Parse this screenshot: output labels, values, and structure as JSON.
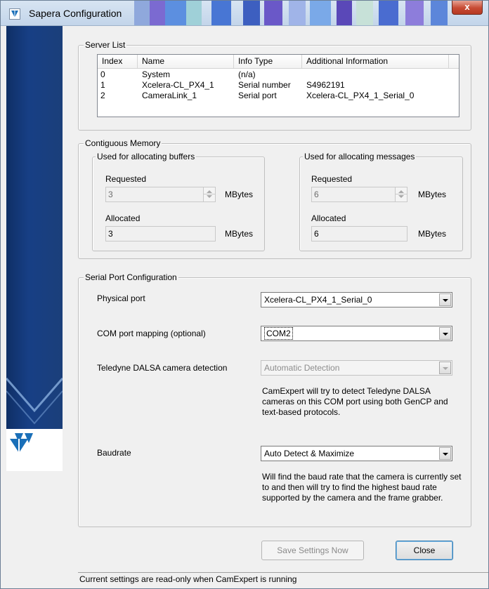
{
  "window": {
    "title": "Sapera Configuration",
    "close_glyph": "x"
  },
  "server_list": {
    "group_label": "Server List",
    "columns": [
      "Index",
      "Name",
      "Info Type",
      "Additional Information"
    ],
    "rows": [
      [
        "0",
        "System",
        "(n/a)",
        ""
      ],
      [
        "1",
        "Xcelera-CL_PX4_1",
        "Serial number",
        "S4962191"
      ],
      [
        "2",
        "CameraLink_1",
        "Serial port",
        "Xcelera-CL_PX4_1_Serial_0"
      ]
    ]
  },
  "contiguous_memory": {
    "group_label": "Contiguous Memory",
    "buffers": {
      "group_label": "Used for allocating buffers",
      "requested_label": "Requested",
      "requested_value": "3",
      "allocated_label": "Allocated",
      "allocated_value": "3",
      "unit": "MBytes"
    },
    "messages": {
      "group_label": "Used for allocating messages",
      "requested_label": "Requested",
      "requested_value": "6",
      "allocated_label": "Allocated",
      "allocated_value": "6",
      "unit": "MBytes"
    }
  },
  "serial_port": {
    "group_label": "Serial Port Configuration",
    "physical_port_label": "Physical port",
    "physical_port_value": "Xcelera-CL_PX4_1_Serial_0",
    "com_mapping_label": "COM port mapping (optional)",
    "com_mapping_value": "COM2",
    "detection_label": "Teledyne DALSA camera detection",
    "detection_value": "Automatic Detection",
    "detection_desc": "CamExpert will try to detect Teledyne DALSA cameras on this COM port using both GenCP and text-based protocols.",
    "baudrate_label": "Baudrate",
    "baudrate_value": "Auto Detect & Maximize",
    "baudrate_desc": "Will find the baud rate that the camera is currently set to and then will try to find the highest baud rate supported by the camera and the frame grabber."
  },
  "buttons": {
    "save_label": "Save Settings Now",
    "close_label": "Close"
  },
  "status": {
    "text": "Current settings are read-only when CamExpert is running"
  },
  "colors": {
    "banner": "#173f85",
    "logo_blue": "#1a6fb8",
    "window_bg": "#f0f0f0"
  }
}
